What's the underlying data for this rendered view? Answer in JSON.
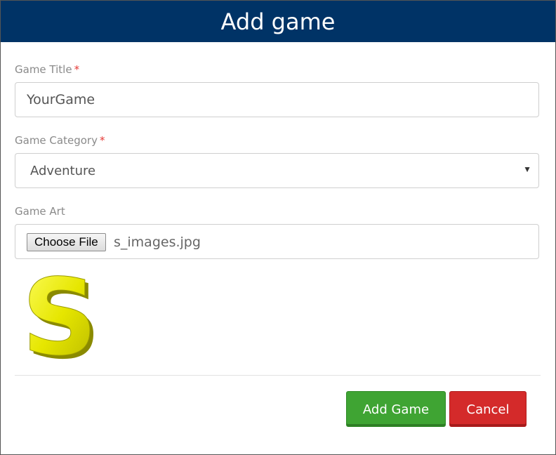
{
  "dialog": {
    "title": "Add game"
  },
  "form": {
    "title_field": {
      "label": "Game Title",
      "required_mark": "*",
      "value": "YourGame"
    },
    "category_field": {
      "label": "Game Category",
      "required_mark": "*",
      "selected": "Adventure"
    },
    "art_field": {
      "label": "Game Art",
      "button_label": "Choose File",
      "file_name": "s_images.jpg",
      "preview_icon": "yellow-letter-s-image"
    }
  },
  "actions": {
    "add_label": "Add Game",
    "cancel_label": "Cancel"
  },
  "colors": {
    "header_bg": "#003366",
    "add_button": "#3fa433",
    "cancel_button": "#d42a2a",
    "required": "#e53935"
  }
}
